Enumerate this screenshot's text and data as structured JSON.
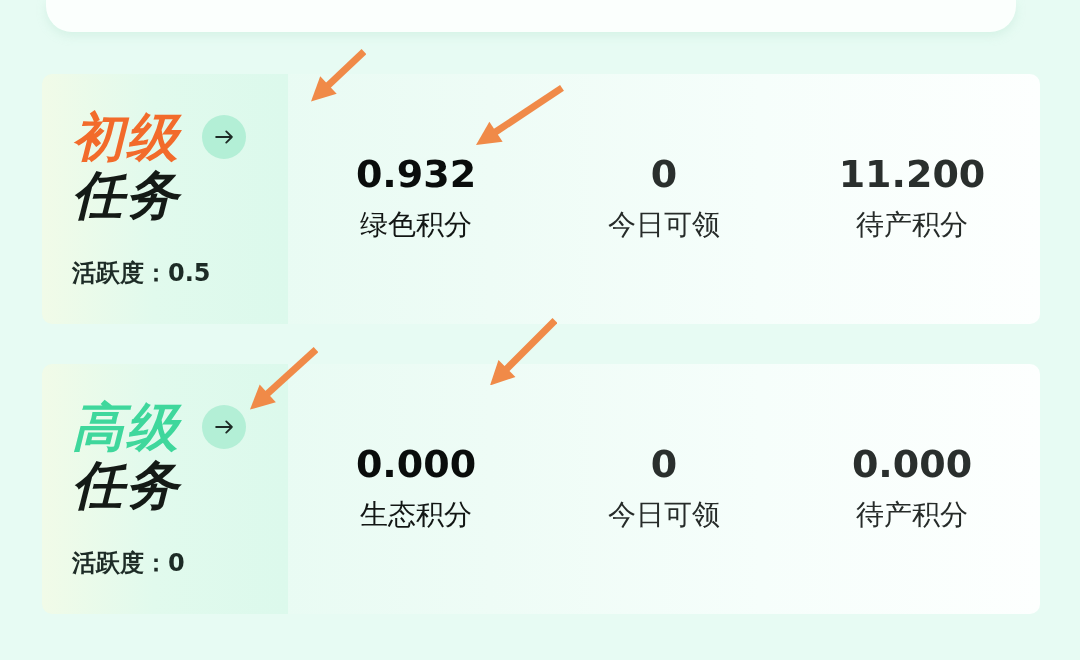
{
  "task_cards": [
    {
      "title_accent": "初级",
      "title": "任务",
      "color": "#f26b2b",
      "activity": "活跃度：0.5",
      "stats": [
        {
          "value": "0.932",
          "label": "绿色积分"
        },
        {
          "value": "0",
          "label": "今日可领"
        },
        {
          "value": "11.200",
          "label": "待产积分"
        }
      ]
    },
    {
      "title_accent": "高级",
      "title": "任务",
      "color": "#3fd79c",
      "activity": "活跃度：0",
      "stats": [
        {
          "value": "0.000",
          "label": "生态积分"
        },
        {
          "value": "0",
          "label": "今日可领"
        },
        {
          "value": "0.000",
          "label": "待产积分"
        }
      ]
    }
  ]
}
